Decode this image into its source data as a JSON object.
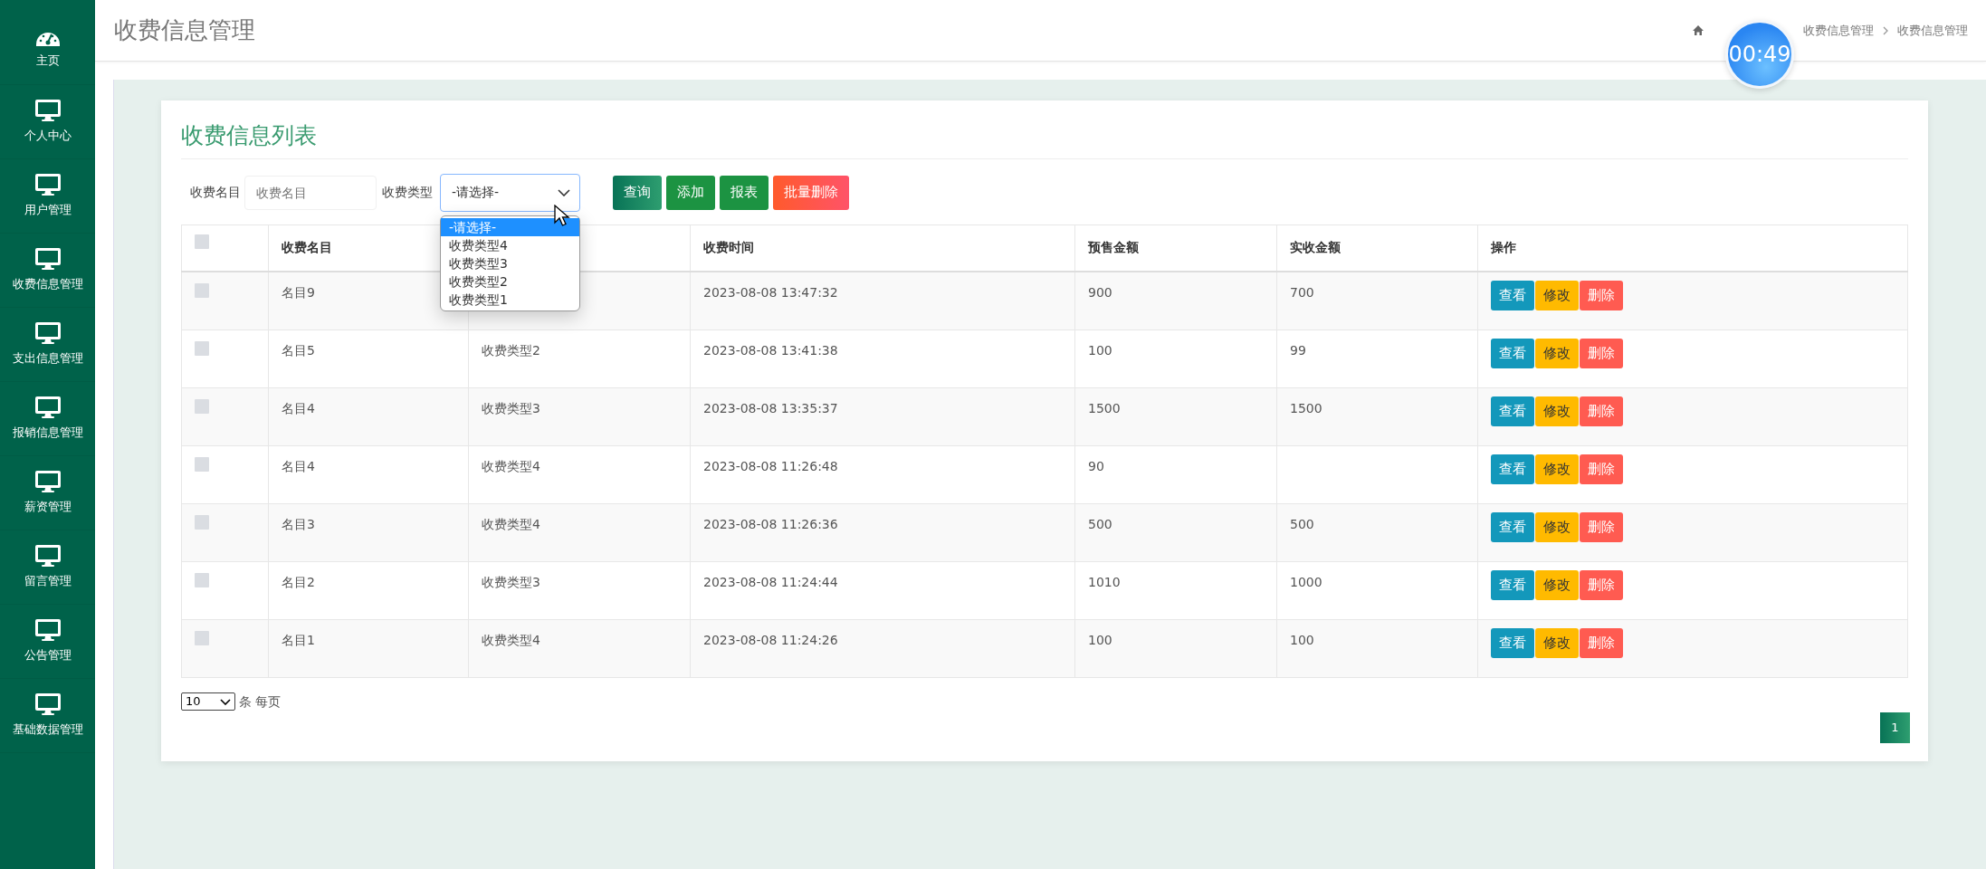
{
  "sidebar": {
    "items": [
      {
        "label": "主页",
        "kind": "dashboard"
      },
      {
        "label": "个人中心",
        "kind": "monitor"
      },
      {
        "label": "用户管理",
        "kind": "monitor"
      },
      {
        "label": "收费信息管理",
        "kind": "monitor"
      },
      {
        "label": "支出信息管理",
        "kind": "monitor"
      },
      {
        "label": "报销信息管理",
        "kind": "monitor"
      },
      {
        "label": "薪资管理",
        "kind": "monitor"
      },
      {
        "label": "留言管理",
        "kind": "monitor"
      },
      {
        "label": "公告管理",
        "kind": "monitor"
      },
      {
        "label": "基础数据管理",
        "kind": "monitor"
      }
    ]
  },
  "header": {
    "title": "收费信息管理",
    "breadcrumb": [
      "收费信息管理",
      "收费信息管理"
    ]
  },
  "timer": "00:49",
  "card": {
    "title": "收费信息列表"
  },
  "filters": {
    "name_label": "收费名目",
    "name_placeholder": "收费名目",
    "type_label": "收费类型",
    "type_value": "-请选择-",
    "open": true,
    "options": [
      {
        "label": "-请选择-",
        "selected": true
      },
      {
        "label": "收费类型4",
        "selected": false
      },
      {
        "label": "收费类型3",
        "selected": false
      },
      {
        "label": "收费类型2",
        "selected": false
      },
      {
        "label": "收费类型1",
        "selected": false
      }
    ]
  },
  "buttons": [
    {
      "label": "查询",
      "kind": "search"
    },
    {
      "label": "添加",
      "kind": "add"
    },
    {
      "label": "报表",
      "kind": "report"
    },
    {
      "label": "批量删除",
      "kind": "bulk-delete"
    }
  ],
  "table": {
    "header_checked": false,
    "columns": [
      {
        "label": "收费名目"
      },
      {},
      {
        "label": "收费时间"
      },
      {
        "label": "预售金额"
      },
      {
        "label": "实收金额"
      },
      {
        "label": "操作"
      }
    ],
    "rows": [
      {
        "checked": false,
        "cells": [
          "名目9",
          null,
          "2023-08-08 13:47:32",
          "900",
          "700"
        ],
        "actions": [
          {
            "label": "查看",
            "kind": "view"
          },
          {
            "label": "修改",
            "kind": "edit"
          },
          {
            "label": "删除",
            "kind": "delete"
          }
        ]
      },
      {
        "checked": false,
        "cells": [
          "名目5",
          "收费类型2",
          "2023-08-08 13:41:38",
          "100",
          "99"
        ],
        "actions": [
          {
            "label": "查看",
            "kind": "view"
          },
          {
            "label": "修改",
            "kind": "edit"
          },
          {
            "label": "删除",
            "kind": "delete"
          }
        ]
      },
      {
        "checked": false,
        "cells": [
          "名目4",
          "收费类型3",
          "2023-08-08 13:35:37",
          "1500",
          "1500"
        ],
        "actions": [
          {
            "label": "查看",
            "kind": "view"
          },
          {
            "label": "修改",
            "kind": "edit"
          },
          {
            "label": "删除",
            "kind": "delete"
          }
        ]
      },
      {
        "checked": false,
        "cells": [
          "名目4",
          "收费类型4",
          "2023-08-08 11:26:48",
          "90",
          null
        ],
        "actions": [
          {
            "label": "查看",
            "kind": "view"
          },
          {
            "label": "修改",
            "kind": "edit"
          },
          {
            "label": "删除",
            "kind": "delete"
          }
        ]
      },
      {
        "checked": false,
        "cells": [
          "名目3",
          "收费类型4",
          "2023-08-08 11:26:36",
          "500",
          "500"
        ],
        "actions": [
          {
            "label": "查看",
            "kind": "view"
          },
          {
            "label": "修改",
            "kind": "edit"
          },
          {
            "label": "删除",
            "kind": "delete"
          }
        ]
      },
      {
        "checked": false,
        "cells": [
          "名目2",
          "收费类型3",
          "2023-08-08 11:24:44",
          "1010",
          "1000"
        ],
        "actions": [
          {
            "label": "查看",
            "kind": "view"
          },
          {
            "label": "修改",
            "kind": "edit"
          },
          {
            "label": "删除",
            "kind": "delete"
          }
        ]
      },
      {
        "checked": false,
        "cells": [
          "名目1",
          "收费类型4",
          "2023-08-08 11:24:26",
          "100",
          "100"
        ],
        "actions": [
          {
            "label": "查看",
            "kind": "view"
          },
          {
            "label": "修改",
            "kind": "edit"
          },
          {
            "label": "删除",
            "kind": "delete"
          }
        ]
      }
    ]
  },
  "page_size": {
    "value": "10",
    "label": "条 每页"
  },
  "pagination": [
    {
      "label": "1",
      "selected": true
    }
  ]
}
